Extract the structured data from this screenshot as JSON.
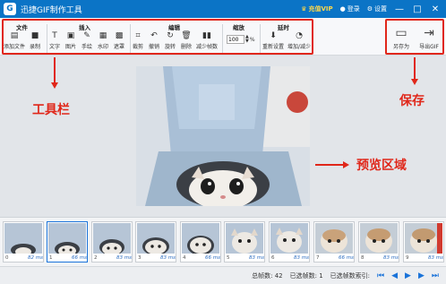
{
  "titlebar": {
    "title": "迅捷GIF制作工具",
    "logo_letter": "G",
    "vip_label": "充值VIP",
    "login_label": "登录",
    "settings_label": "设置",
    "min_glyph": "—",
    "max_glyph": "□",
    "close_glyph": "✕"
  },
  "toolbar": {
    "groups": {
      "file": "文件",
      "insert": "插入",
      "edit": "编辑",
      "zoom": "缩放",
      "delay": "延时"
    },
    "tools": {
      "add_file": "添加文件",
      "record": "录制",
      "text": "文字",
      "image": "图片",
      "handwrite": "手绘",
      "watermark": "水印",
      "mask": "遮罩",
      "crop": "裁剪",
      "undo": "撤销",
      "rotate": "旋转",
      "delete": "删除",
      "reduce_frames": "减少帧数",
      "reset": "重新设置",
      "increase_decrease": "增加/减少"
    },
    "zoom_value": "100",
    "zoom_unit": "%",
    "save_as": "另存为",
    "export_gif": "导出GIF"
  },
  "annotations": {
    "toolbar": "工具栏",
    "save": "保存",
    "preview": "预览区域"
  },
  "frames": [
    {
      "index": "0",
      "ms": "82 ms"
    },
    {
      "index": "1",
      "ms": "66 ms"
    },
    {
      "index": "2",
      "ms": "83 ms"
    },
    {
      "index": "3",
      "ms": "83 ms"
    },
    {
      "index": "4",
      "ms": "66 ms"
    },
    {
      "index": "5",
      "ms": "83 ms"
    },
    {
      "index": "6",
      "ms": "83 ms"
    },
    {
      "index": "7",
      "ms": "66 ms"
    },
    {
      "index": "8",
      "ms": "83 ms"
    },
    {
      "index": "9",
      "ms": "83 ms"
    }
  ],
  "status": {
    "total_frames": "总帧数: 42",
    "selected_frames": "已选帧数: 1",
    "selected_index": "已选帧数索引:"
  },
  "colors": {
    "title_bar": "#0b74c6",
    "annotation_red": "#e0271a",
    "selection_blue": "#1a73d9"
  }
}
